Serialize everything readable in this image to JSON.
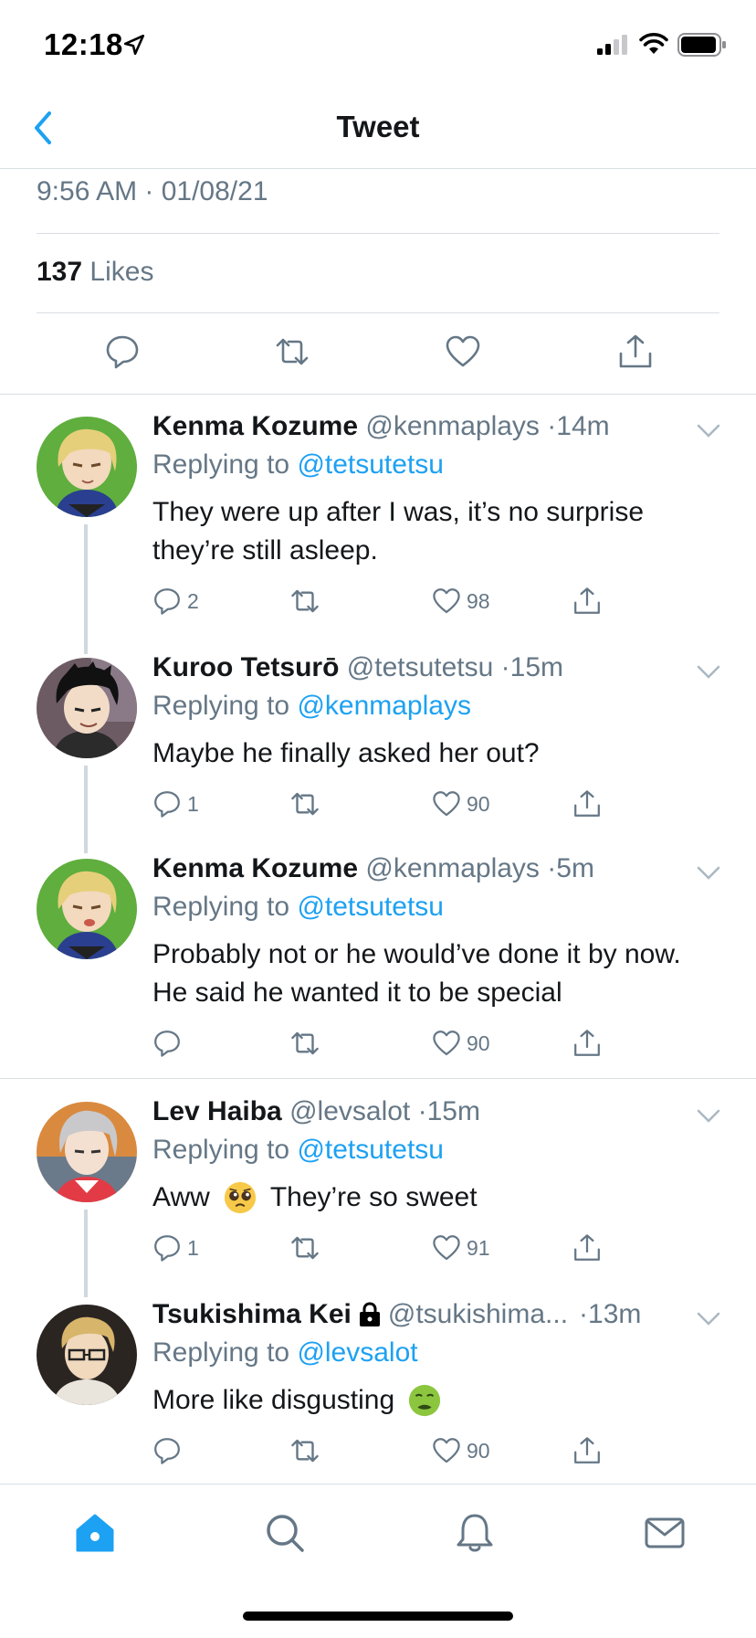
{
  "status_bar": {
    "time": "12:18"
  },
  "nav": {
    "title": "Tweet"
  },
  "detail": {
    "timestamp": "9:56 AM · 01/08/21",
    "likes_count": "137",
    "likes_label": "Likes"
  },
  "replies": [
    {
      "name": "Kenma Kozume",
      "handle": "@kenmaplays",
      "time": "14m",
      "replying_prefix": "Replying to",
      "replying_to": "@tetsutetsu",
      "text": "They were up after I was, it’s no surprise they’re still asleep.",
      "reply_count": "2",
      "like_count": "98"
    },
    {
      "name": "Kuroo Tetsurō",
      "handle": "@tetsutetsu",
      "time": "15m",
      "replying_prefix": "Replying to",
      "replying_to": "@kenmaplays",
      "text": "Maybe he finally asked her out?",
      "reply_count": "1",
      "like_count": "90"
    },
    {
      "name": "Kenma Kozume",
      "handle": "@kenmaplays",
      "time": "5m",
      "replying_prefix": "Replying to",
      "replying_to": "@tetsutetsu",
      "text": "Probably not or he would’ve done it by now. He said he wanted it to be special",
      "reply_count": "",
      "like_count": "90"
    },
    {
      "name": "Lev Haiba",
      "handle": "@levsalot",
      "time": "15m",
      "replying_prefix": "Replying to",
      "replying_to": "@tetsutetsu",
      "text_before": "Aww",
      "text_after": "They’re so sweet",
      "emoji": "pleading-face",
      "reply_count": "1",
      "like_count": "91"
    },
    {
      "name": "Tsukishima Kei",
      "handle": "@tsukishima...",
      "time": "13m",
      "replying_prefix": "Replying to",
      "replying_to": "@levsalot",
      "text_before": "More like disgusting",
      "emoji": "nauseated-face",
      "reply_count": "",
      "like_count": "90"
    }
  ],
  "icons": {
    "reply": "speech-bubble-icon",
    "retweet": "retweet-icon",
    "like": "heart-icon",
    "share": "share-icon",
    "tabs": [
      "home-icon",
      "search-icon",
      "bell-icon",
      "mail-icon"
    ]
  },
  "colors": {
    "accent": "#1da1f2",
    "muted": "#657786",
    "text": "#14171a",
    "divider": "#dadfe3"
  }
}
